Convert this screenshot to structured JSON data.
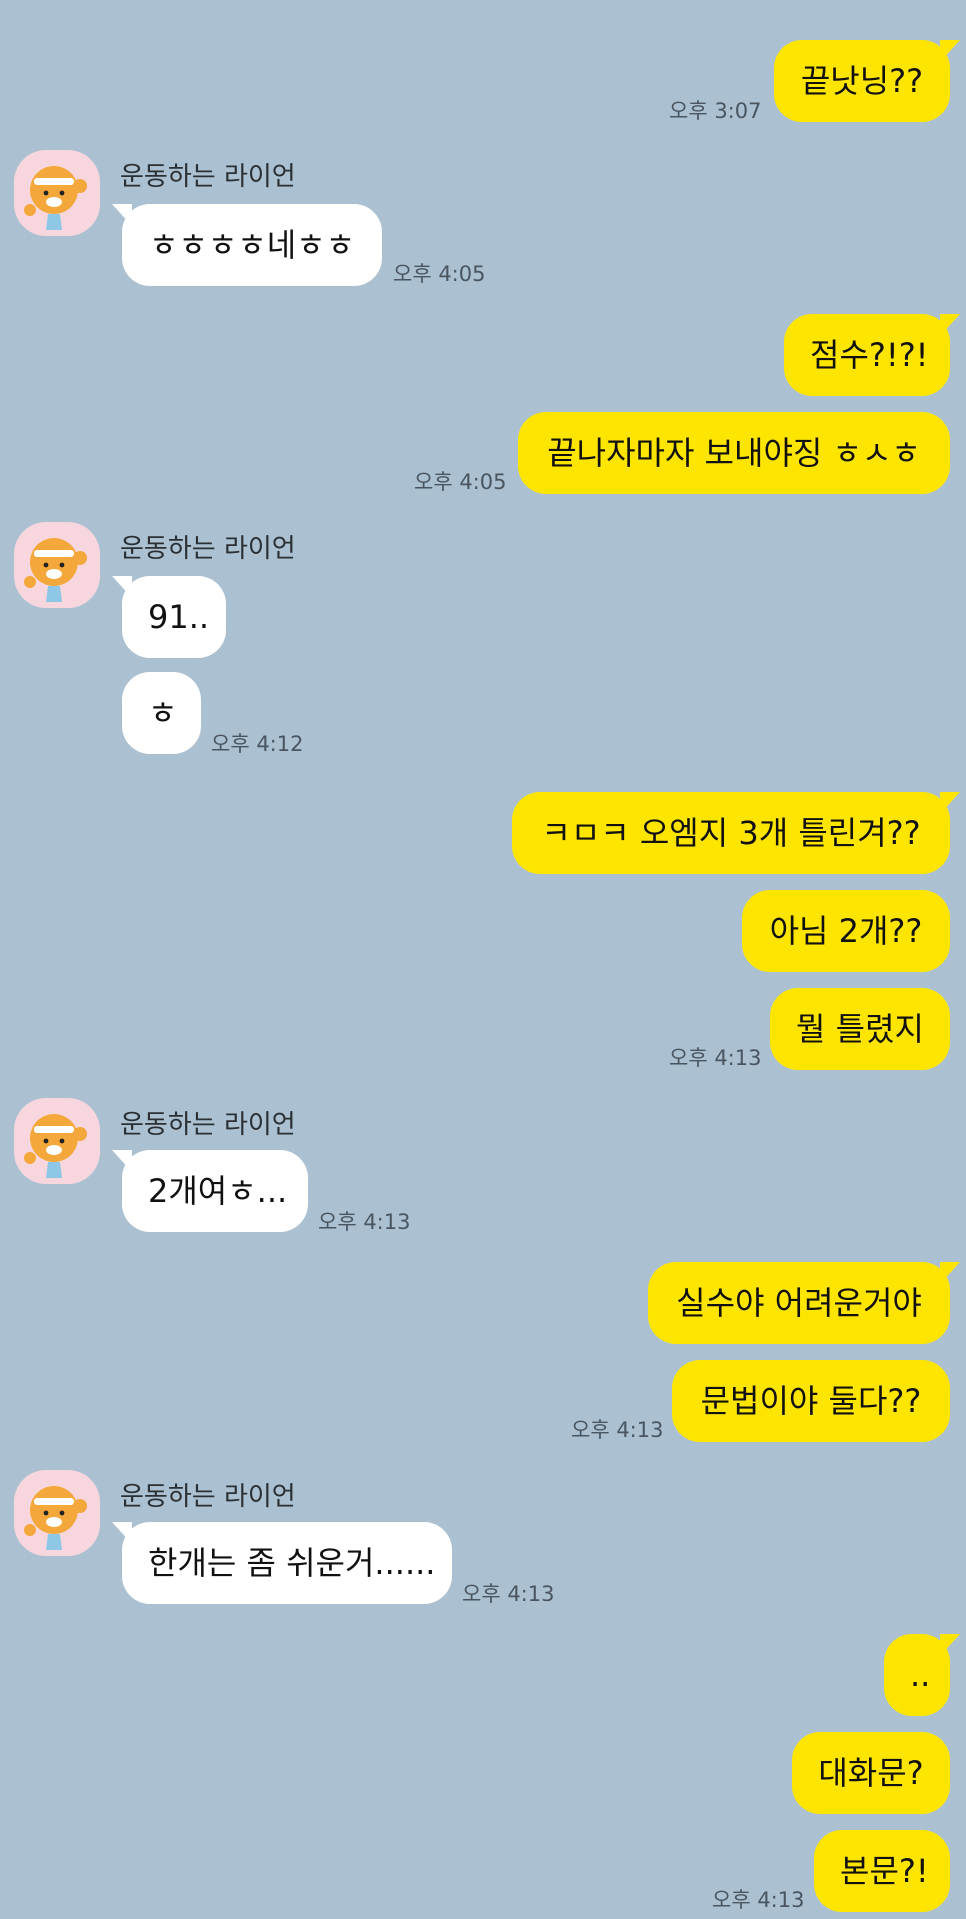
{
  "contact": {
    "name": "운동하는 라이언"
  },
  "colors": {
    "background": "#abc1d1",
    "outgoing_bubble": "#fee500",
    "incoming_bubble": "#ffffff",
    "avatar_bg": "#f7d6de"
  },
  "messages": {
    "m1": {
      "text": "끝낫닝??",
      "time": "오후 3:07"
    },
    "m2": {
      "text": "ㅎㅎㅎㅎ네ㅎㅎ",
      "time": "오후 4:05"
    },
    "m3": {
      "text": "점수?!?!"
    },
    "m4": {
      "text": "끝나자마자 보내야징 ㅎㅅㅎ",
      "time": "오후 4:05"
    },
    "m5": {
      "text": "91.."
    },
    "m6": {
      "text": "ㅎ",
      "time": "오후 4:12"
    },
    "m7": {
      "text": "ㅋㅁㅋ 오엠지 3개 틀린겨??"
    },
    "m8": {
      "text": "아님 2개??"
    },
    "m9": {
      "text": "뭘 틀렸지",
      "time": "오후 4:13"
    },
    "m10": {
      "text": "2개여ㅎ...",
      "time": "오후 4:13"
    },
    "m11": {
      "text": "실수야 어려운거야"
    },
    "m12": {
      "text": "문법이야 둘다??",
      "time": "오후 4:13"
    },
    "m13": {
      "text": "한개는 좀 쉬운거......",
      "time": "오후 4:13"
    },
    "m14": {
      "text": ".."
    },
    "m15": {
      "text": "대화문?"
    },
    "m16": {
      "text": "본문?!",
      "time": "오후 4:13"
    }
  },
  "icons": {
    "avatar": "ryan-character-avatar-icon"
  }
}
